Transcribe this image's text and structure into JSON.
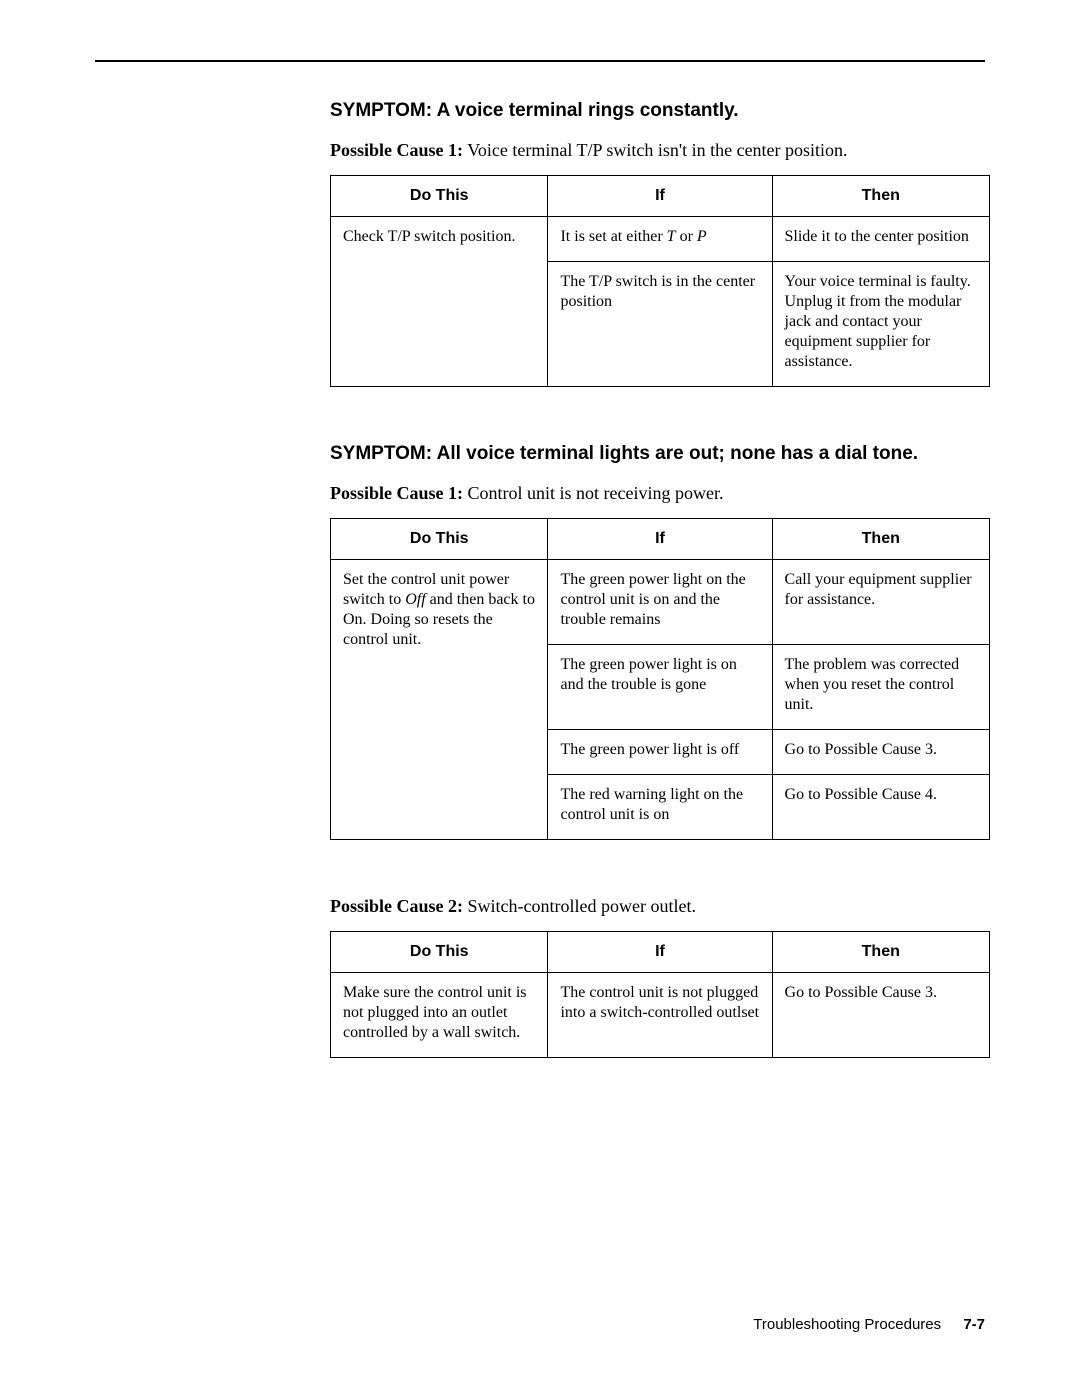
{
  "symptom1": {
    "heading": "SYMPTOM: A voice terminal rings constantly.",
    "cause1_label": "Possible Cause 1:",
    "cause1_text": " Voice terminal T/P switch isn't in the center position.",
    "table": {
      "headers": {
        "do": "Do This",
        "if": "If",
        "then": "Then"
      },
      "rows": [
        {
          "do": "Check T/P switch position.",
          "if_pre": "It is set at either ",
          "if_T": "T",
          "if_mid": " or ",
          "if_P": "P",
          "then": "Slide it to the center position"
        },
        {
          "if": "The T/P switch is in the center position",
          "then": "Your voice terminal is faulty. Unplug it from the modular jack and contact your equipment supplier for assistance."
        }
      ]
    }
  },
  "symptom2": {
    "heading": "SYMPTOM: All voice terminal lights are out; none has a dial tone.",
    "cause1_label": "Possible Cause 1:",
    "cause1_text": " Control unit is not receiving power.",
    "table1": {
      "headers": {
        "do": "Do This",
        "if": "If",
        "then": "Then"
      },
      "rows": [
        {
          "do_pre": "Set the control unit power switch to ",
          "do_off": "Off",
          "do_post": " and then back to On. Doing so resets the control unit.",
          "if": "The green power light on the control unit is on and the trouble remains",
          "then": "Call your equipment supplier for assistance."
        },
        {
          "if": "The green power light is on and the trouble is gone",
          "then": "The problem was corrected when you reset the control unit."
        },
        {
          "if": "The green power light is off",
          "then": "Go to Possible Cause 3."
        },
        {
          "if": "The red warning light on the control unit is on",
          "then": "Go to Possible Cause 4."
        }
      ]
    },
    "cause2_label": "Possible Cause 2:",
    "cause2_text": " Switch-controlled power outlet.",
    "table2": {
      "headers": {
        "do": "Do This",
        "if": "If",
        "then": "Then"
      },
      "rows": [
        {
          "do": "Make sure the control unit is not plugged into an outlet controlled by a wall switch.",
          "if": "The control unit is not plugged into a switch-controlled outlset",
          "then": "Go to Possible Cause 3."
        }
      ]
    }
  },
  "footer": {
    "label": "Troubleshooting Procedures",
    "page": "7-7"
  }
}
